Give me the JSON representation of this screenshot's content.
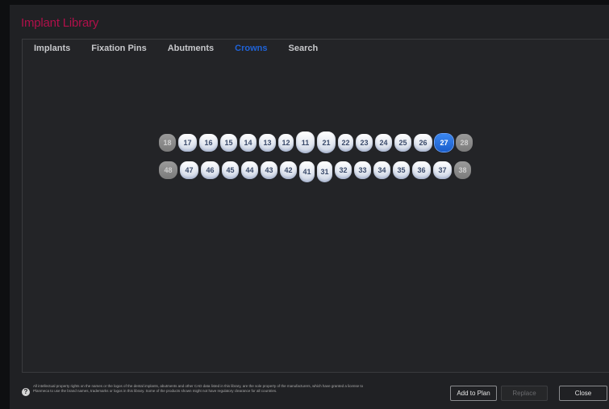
{
  "title": "Implant Library",
  "tabs": [
    {
      "label": "Implants",
      "active": false
    },
    {
      "label": "Fixation Pins",
      "active": false
    },
    {
      "label": "Abutments",
      "active": false
    },
    {
      "label": "Crowns",
      "active": true
    },
    {
      "label": "Search",
      "active": false
    }
  ],
  "teeth": {
    "upper": [
      {
        "n": "18",
        "state": "disabled",
        "size": "m"
      },
      {
        "n": "17",
        "state": "normal",
        "size": "l"
      },
      {
        "n": "16",
        "state": "normal",
        "size": "l"
      },
      {
        "n": "15",
        "state": "normal",
        "size": "m"
      },
      {
        "n": "14",
        "state": "normal",
        "size": "m"
      },
      {
        "n": "13",
        "state": "normal",
        "size": "m"
      },
      {
        "n": "12",
        "state": "normal",
        "size": "s"
      },
      {
        "n": "11",
        "state": "normal",
        "size": "l",
        "tall": true
      },
      {
        "n": "21",
        "state": "normal",
        "size": "l",
        "tall": true
      },
      {
        "n": "22",
        "state": "normal",
        "size": "s"
      },
      {
        "n": "23",
        "state": "normal",
        "size": "m"
      },
      {
        "n": "24",
        "state": "normal",
        "size": "m"
      },
      {
        "n": "25",
        "state": "normal",
        "size": "m"
      },
      {
        "n": "26",
        "state": "normal",
        "size": "l"
      },
      {
        "n": "27",
        "state": "selected",
        "size": "l"
      },
      {
        "n": "28",
        "state": "disabled",
        "size": "m"
      }
    ],
    "lower": [
      {
        "n": "48",
        "state": "disabled",
        "size": "l"
      },
      {
        "n": "47",
        "state": "normal",
        "size": "l"
      },
      {
        "n": "46",
        "state": "normal",
        "size": "l"
      },
      {
        "n": "45",
        "state": "normal",
        "size": "m"
      },
      {
        "n": "44",
        "state": "normal",
        "size": "m"
      },
      {
        "n": "43",
        "state": "normal",
        "size": "m"
      },
      {
        "n": "42",
        "state": "normal",
        "size": "m"
      },
      {
        "n": "41",
        "state": "normal",
        "size": "s",
        "tall": true
      },
      {
        "n": "31",
        "state": "normal",
        "size": "s",
        "tall": true
      },
      {
        "n": "32",
        "state": "normal",
        "size": "m"
      },
      {
        "n": "33",
        "state": "normal",
        "size": "m"
      },
      {
        "n": "34",
        "state": "normal",
        "size": "m"
      },
      {
        "n": "35",
        "state": "normal",
        "size": "m"
      },
      {
        "n": "36",
        "state": "normal",
        "size": "l"
      },
      {
        "n": "37",
        "state": "normal",
        "size": "l"
      },
      {
        "n": "38",
        "state": "disabled",
        "size": "m"
      }
    ]
  },
  "footer": {
    "info_icon": "help-icon",
    "notice": "All intellectual property rights on the names or the logos of the dental implants, abutments and other CAD data listed in this library, are the sole property of the manufacturers, which have granted a license to Planmeca to use the brand names, trademarks or logos in this library. Some of the products shown might not have regulatory clearance for all countries.",
    "add_label": "Add to Plan",
    "replace_label": "Replace",
    "close_label": "Close"
  },
  "colors": {
    "title": "#b0104a",
    "active_tab": "#1f63d8",
    "selected_tooth": "#1a5ecc"
  }
}
